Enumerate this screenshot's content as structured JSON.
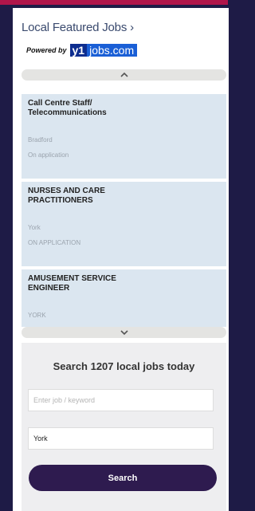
{
  "header": {
    "title": "Local Featured Jobs ›"
  },
  "powered": {
    "label": "Powered by",
    "logo_mark": "y1",
    "logo_text": "jobs.com"
  },
  "icons": {
    "up": "chevron-up-icon",
    "down": "chevron-down-icon"
  },
  "colors": {
    "accent_bar": "#b0154a",
    "button": "#2e1b4f",
    "job_bg": "#dbe6f0",
    "page_bg": "#1e1b46"
  },
  "jobs": [
    {
      "title": "Call Centre Staff/ Telecommunications",
      "location": "Bradford",
      "salary": "On application"
    },
    {
      "title": "NURSES AND CARE PRACTITIONERS",
      "location": "York",
      "salary": "ON APPLICATION"
    },
    {
      "title": "AMUSEMENT SERVICE ENGINEER",
      "location": "YORK",
      "salary": ""
    }
  ],
  "search": {
    "heading": "Search 1207 local jobs today",
    "keyword_placeholder": "Enter job / keyword",
    "location_value": "York",
    "button_label": "Search"
  }
}
